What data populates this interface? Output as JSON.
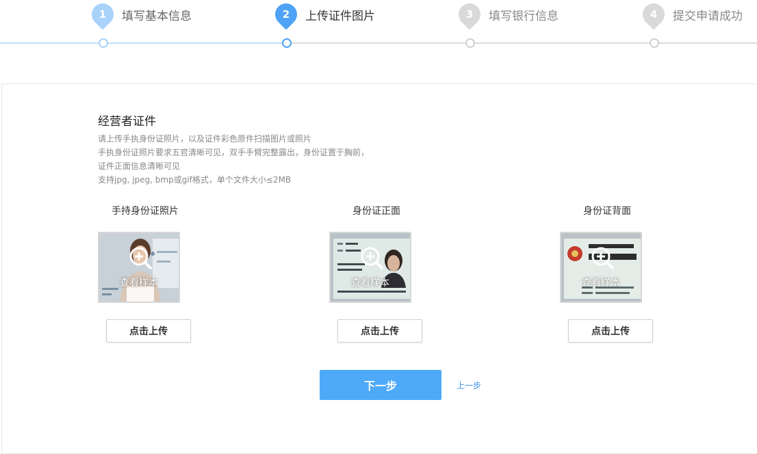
{
  "stepper": {
    "steps": [
      {
        "num": "1",
        "label": "填写基本信息",
        "state": "done"
      },
      {
        "num": "2",
        "label": "上传证件图片",
        "state": "active"
      },
      {
        "num": "3",
        "label": "填写银行信息",
        "state": "todo"
      },
      {
        "num": "4",
        "label": "提交申请成功",
        "state": "todo"
      }
    ]
  },
  "section": {
    "title": "经营者证件",
    "description": [
      "请上传手执身份证照片，以及证件彩色原件扫描图片或照片",
      "手执身份证照片要求五官清晰可见，双手手臂完整露出，身份证置于胸前，",
      "证件正面信息清晰可见",
      "支持jpg, jpeg, bmp或gif格式，单个文件大小≤2MB"
    ]
  },
  "documents": [
    {
      "title": "手持身份证照片",
      "sample_label": "查看样本",
      "upload_label": "点击上传",
      "icon": "zoom-in-icon"
    },
    {
      "title": "身份证正面",
      "sample_label": "查看样本",
      "upload_label": "点击上传",
      "icon": "zoom-in-icon"
    },
    {
      "title": "身份证背面",
      "sample_label": "查看样本",
      "upload_label": "点击上传",
      "icon": "zoom-in-icon"
    }
  ],
  "actions": {
    "next_label": "下一步",
    "prev_label": "上一步"
  },
  "colors": {
    "accent": "#4ea9f8",
    "step_done": "#a9d2fb",
    "step_active": "#4ea3f6",
    "step_todo": "#d9d9d9",
    "link": "#3a8ee6"
  }
}
